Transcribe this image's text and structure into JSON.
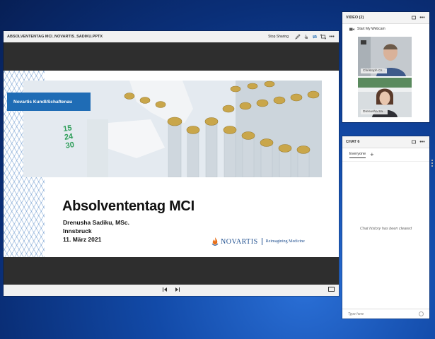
{
  "share_pod": {
    "title": "ABSOLVENTENTAG MCI_NOVARTIS_SADIKU.PPTX",
    "stop_sharing_label": "Stop Sharing"
  },
  "slide": {
    "blue_label": "Novartis Kundl/Schaftenau",
    "title": "Absolvententag MCI",
    "speaker": "Drenusha Sadiku, MSc.",
    "city": "Innsbruck",
    "date": "11. März 2021",
    "brand_name": "NOVARTIS",
    "brand_tagline": "Reimagining Medicine",
    "vial_numbers": [
      "15",
      "24",
      "30"
    ]
  },
  "video_pod": {
    "title": "VIDEO (2)",
    "start_webcam_label": "Start My Webcam",
    "participants": [
      {
        "name": "Christoph Gr..."
      },
      {
        "name": "Drenusha Sa..."
      }
    ]
  },
  "chat_pod": {
    "title": "CHAT 6",
    "tab_everyone": "Everyone",
    "tab_add": "+",
    "empty_message": "Chat history has been cleared",
    "input_placeholder": "Type here"
  },
  "colors": {
    "accent_blue": "#1f6cb5",
    "novartis_blue": "#1f4f8f",
    "desktop_blue": "#124aa8"
  }
}
